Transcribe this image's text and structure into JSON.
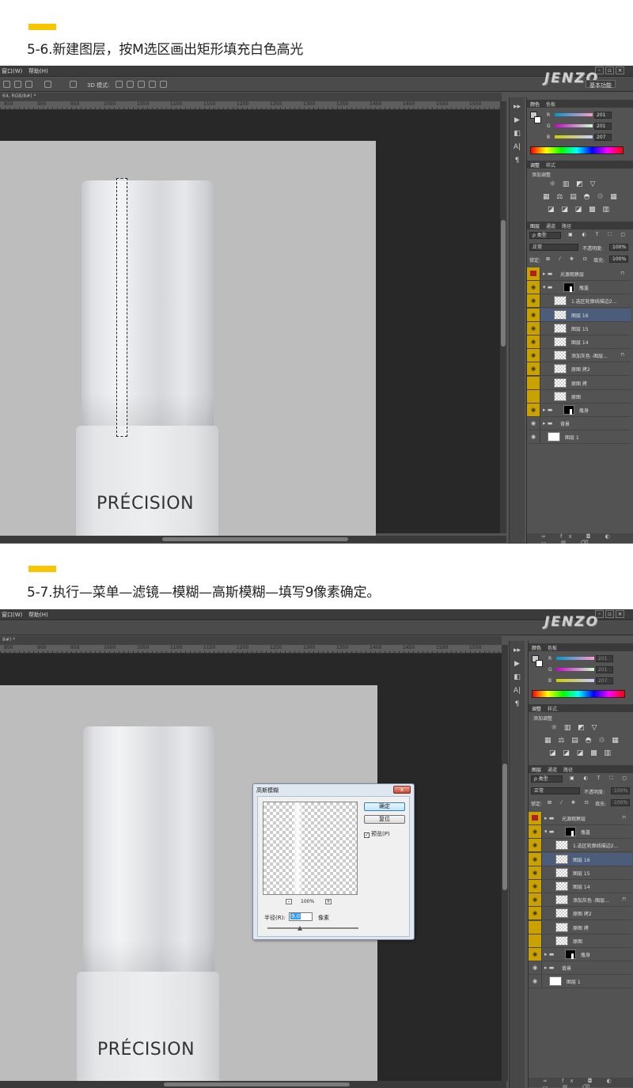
{
  "steps": [
    {
      "title": "5-6.新建图层，按M选区画出矩形填充白色高光"
    },
    {
      "title": "5-7.执行—菜单—滤镜—模糊—高斯模糊—填写9像素确定。"
    }
  ],
  "app": {
    "menu_window": "窗口(W)",
    "menu_help": "帮助(H)",
    "workspace": "基本功能",
    "watermark": "JENZO",
    "mode_3d": "3D 模式:",
    "doc_tab": "64, RGB/8#) *",
    "doc_tab2": "8#) *",
    "ruler_ticks": [
      "850",
      "900",
      "950",
      "1000",
      "1050",
      "1100",
      "1150",
      "1200",
      "1250",
      "1300",
      "1350",
      "1400",
      "1450",
      "1500",
      "1550"
    ],
    "brand_text": "PRÉCISION",
    "win_min": "-",
    "win_max": "▫",
    "win_close": "×"
  },
  "color_panel": {
    "tab_color": "颜色",
    "tab_swatches": "色板",
    "r_label": "R",
    "r": "201",
    "g_label": "G",
    "g": "201",
    "b_label": "B",
    "b": "207",
    "fg": "#c9c9cf"
  },
  "adjust_panel": {
    "tab_adjust": "调整",
    "tab_style": "样式",
    "add_label": "添加调整",
    "icons_row1": "☼ ▥ ◩ ▽",
    "icons_row2": "▦ ⚖ ▤ ◓ ♲ ▦",
    "icons_row3": "◪ ◪ ◪ ▩ ▥"
  },
  "layers_panel": {
    "tab_layers": "图层",
    "tab_channels": "通道",
    "tab_paths": "路径",
    "kind": "ρ 类型",
    "blend": "正常",
    "opacity_label": "不透明度:",
    "opacity": "100%",
    "lock_label": "锁定:",
    "fill_label": "填充:",
    "fill": "100%",
    "footer_icons": "∞ fx ◘ ◐ ▭ ▥ ⌫",
    "layers": [
      {
        "name": "光源观察层",
        "eye": "red",
        "type": "group",
        "lock": true,
        "indent": 0
      },
      {
        "name": "瓶盖",
        "eye": "yellow",
        "type": "group-mask",
        "lock": false,
        "indent": 0,
        "open": true
      },
      {
        "name": "1.选区轮廓线描边2...",
        "eye": "yellow",
        "type": "layer",
        "lock": false,
        "indent": 1
      },
      {
        "name": "图层 16",
        "eye": "yellow",
        "type": "layer",
        "lock": false,
        "indent": 1,
        "selected": true
      },
      {
        "name": "图层 15",
        "eye": "yellow",
        "type": "layer",
        "lock": false,
        "indent": 1
      },
      {
        "name": "图层 14",
        "eye": "yellow",
        "type": "layer",
        "lock": false,
        "indent": 1
      },
      {
        "name": "添加灰色 -图层...",
        "eye": "yellow",
        "type": "layer",
        "lock": true,
        "indent": 1
      },
      {
        "name": "原图 拷2",
        "eye": "yellow",
        "type": "layer",
        "lock": false,
        "indent": 1
      },
      {
        "name": "原图 拷",
        "eye": "yellow-off",
        "type": "layer",
        "lock": false,
        "indent": 1
      },
      {
        "name": "原图",
        "eye": "yellow-off",
        "type": "layer",
        "lock": false,
        "indent": 1
      },
      {
        "name": "瓶身",
        "eye": "yellow",
        "type": "group-mask",
        "lock": false,
        "indent": 0
      },
      {
        "name": "背景",
        "eye": "plain",
        "type": "group",
        "lock": false,
        "indent": 0
      },
      {
        "name": "图层 1",
        "eye": "plain",
        "type": "white",
        "lock": false,
        "indent": 0
      }
    ]
  },
  "gaussian_dialog": {
    "title": "高斯模糊",
    "ok": "确定",
    "reset": "复位",
    "preview_label": "预览(P)",
    "zoom": "100%",
    "radius_label": "半径(R):",
    "radius": "9.0",
    "unit": "像素",
    "close": "x",
    "zoom_minus": "-",
    "zoom_plus": "+"
  },
  "tools": [
    "▸▸",
    "▶",
    "◧",
    "A|",
    "¶"
  ]
}
